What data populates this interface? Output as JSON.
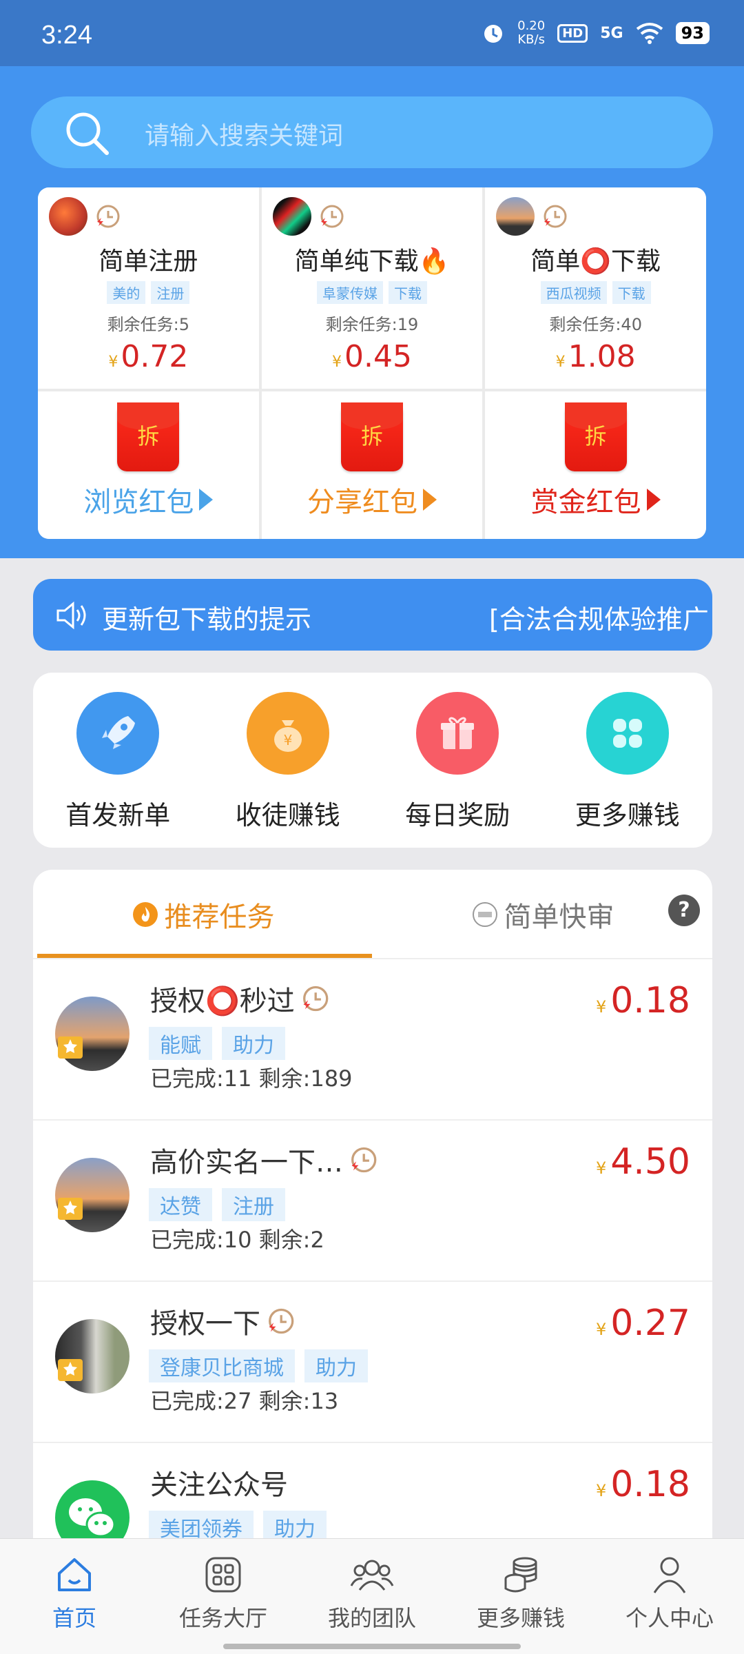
{
  "status": {
    "time": "3:24",
    "speed_top": "0.20",
    "speed_unit": "KB/s",
    "hd": "HD",
    "net": "5G",
    "battery": "93"
  },
  "search": {
    "placeholder": "请输入搜索关键词"
  },
  "featured": [
    {
      "title": "简单注册",
      "tags": [
        "美的",
        "注册"
      ],
      "remaining": "剩余任务:5",
      "price": "0.72"
    },
    {
      "title": "简单纯下载🔥",
      "tags": [
        "阜蒙传媒",
        "下载"
      ],
      "remaining": "剩余任务:19",
      "price": "0.45"
    },
    {
      "title": "简单⭕下载",
      "tags": [
        "西瓜视频",
        "下载"
      ],
      "remaining": "剩余任务:40",
      "price": "1.08"
    }
  ],
  "redpackets": [
    {
      "label": "浏览红包",
      "color": "#4aa3e8",
      "glyph": "拆"
    },
    {
      "label": "分享红包",
      "color": "#ef8c1f",
      "glyph": "拆"
    },
    {
      "label": "赏金红包",
      "color": "#e0251b",
      "glyph": "拆"
    }
  ],
  "notice": {
    "text1": "更新包下载的提示",
    "text2": "[合法合规体验推广"
  },
  "quick": [
    {
      "label": "首发新单",
      "icon": "rocket-icon",
      "color": "#4198ef"
    },
    {
      "label": "收徒赚钱",
      "icon": "money-bag-icon",
      "color": "#f7a02b"
    },
    {
      "label": "每日奖励",
      "icon": "gift-icon",
      "color": "#f85c66"
    },
    {
      "label": "更多赚钱",
      "icon": "clover-icon",
      "color": "#27d3d3"
    }
  ],
  "tabs": {
    "recommended": "推荐任务",
    "quick_review": "简单快审",
    "help": "?"
  },
  "yen": "¥",
  "tasks": [
    {
      "title": "授权⭕秒过",
      "tags": [
        "能赋",
        "助力"
      ],
      "stats": "已完成:11  剩余:189",
      "price": "0.18"
    },
    {
      "title": "高价实名一下…",
      "tags": [
        "达赞",
        "注册"
      ],
      "stats": "已完成:10  剩余:2",
      "price": "4.50"
    },
    {
      "title": "授权一下",
      "tags": [
        "登康贝比商城",
        "助力"
      ],
      "stats": "已完成:27  剩余:13",
      "price": "0.27"
    },
    {
      "title": "关注公众号",
      "tags": [
        "美团领券",
        "助力"
      ],
      "stats": "",
      "price": "0.18"
    }
  ],
  "nav": [
    {
      "label": "首页",
      "icon": "home-icon"
    },
    {
      "label": "任务大厅",
      "icon": "grid-icon"
    },
    {
      "label": "我的团队",
      "icon": "team-icon"
    },
    {
      "label": "更多赚钱",
      "icon": "coins-icon"
    },
    {
      "label": "个人中心",
      "icon": "person-icon"
    }
  ]
}
